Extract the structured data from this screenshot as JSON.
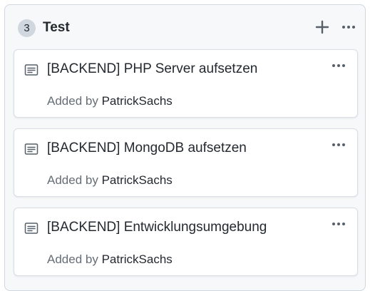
{
  "column": {
    "count": "3",
    "title": "Test",
    "add_icon": "plus-icon",
    "more_icon": "kebab-horizontal-icon"
  },
  "cards": [
    {
      "icon": "note-icon",
      "title": "[BACKEND] PHP Server aufsetzen",
      "added_by_prefix": "Added by",
      "author": "PatrickSachs"
    },
    {
      "icon": "note-icon",
      "title": "[BACKEND] MongoDB aufsetzen",
      "added_by_prefix": "Added by",
      "author": "PatrickSachs"
    },
    {
      "icon": "note-icon",
      "title": "[BACKEND] Entwicklungsumgebung",
      "added_by_prefix": "Added by",
      "author": "PatrickSachs"
    }
  ],
  "colors": {
    "column_bg": "#f6f8fa",
    "card_bg": "#ffffff",
    "text_primary": "#24292f",
    "text_muted": "#656d76",
    "badge_bg": "#d0d7de"
  }
}
